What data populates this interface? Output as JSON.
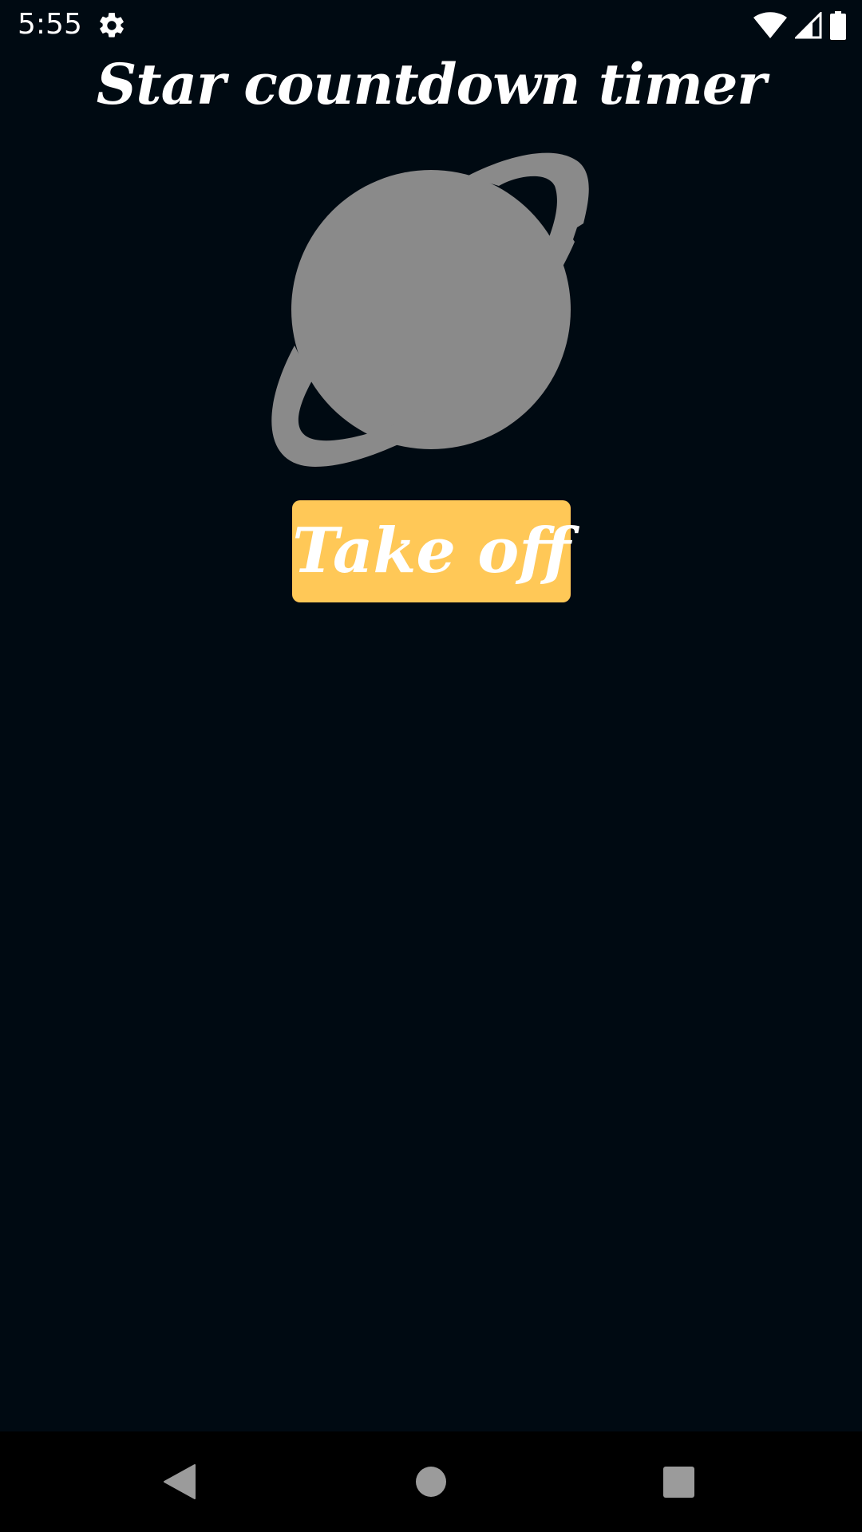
{
  "status_bar": {
    "time": "5:55",
    "icons": [
      "settings-gear-icon",
      "wifi-icon",
      "cellular-signal-icon",
      "battery-icon"
    ]
  },
  "app": {
    "title": "Star countdown timer",
    "planet_icon": "planet-icon",
    "planet_color": "#8a8a8a",
    "takeoff_label": "Take off",
    "button_color": "#ffc857",
    "background_color": "#000a12"
  },
  "nav_bar": {
    "icons": [
      "back-icon",
      "home-icon",
      "recents-icon"
    ]
  }
}
